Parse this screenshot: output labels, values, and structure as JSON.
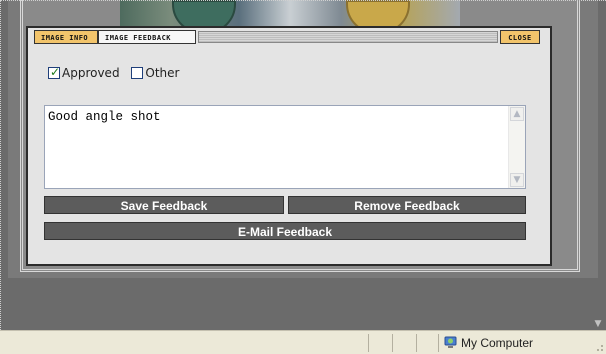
{
  "tabs": {
    "image_info": "IMAGE INFO",
    "image_feedback": "IMAGE FEEDBACK",
    "close": "CLOSE"
  },
  "checkboxes": [
    {
      "label": "Approved",
      "checked": true
    },
    {
      "label": "Other",
      "checked": false
    }
  ],
  "feedback_text": "Good angle shot",
  "buttons": {
    "save": "Save Feedback",
    "remove": "Remove Feedback",
    "email": "E-Mail Feedback"
  },
  "status": {
    "zone_label": "My Computer",
    "zone_icon": "computer-globe-icon"
  },
  "colors": {
    "tab_accent": "#f2c46b",
    "button_bg": "#5c5c5c",
    "statusbar_bg": "#ece9d8"
  }
}
